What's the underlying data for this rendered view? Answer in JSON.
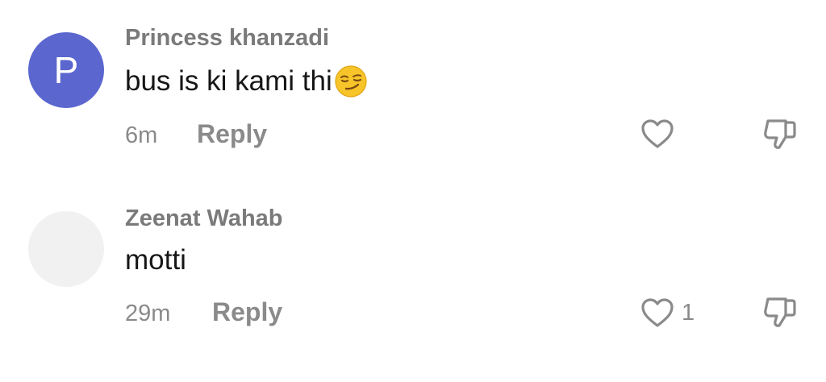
{
  "comments": [
    {
      "avatar_letter": "P",
      "avatar_color": "#5b67cf",
      "author": "Princess khanzadi",
      "text": "bus is ki kami thi",
      "emoji": "smirking-face",
      "time": "6m",
      "reply_label": "Reply",
      "like_count": ""
    },
    {
      "avatar_letter": "",
      "avatar_color": "#f1f1f1",
      "author": "Zeenat Wahab",
      "text": "motti",
      "time": "29m",
      "reply_label": "Reply",
      "like_count": "1"
    }
  ],
  "icons": {
    "like": "heart-outline-icon",
    "dislike": "thumbs-down-outline-icon"
  },
  "colors": {
    "muted_text": "#8a8a8a",
    "body_text": "#161616"
  }
}
